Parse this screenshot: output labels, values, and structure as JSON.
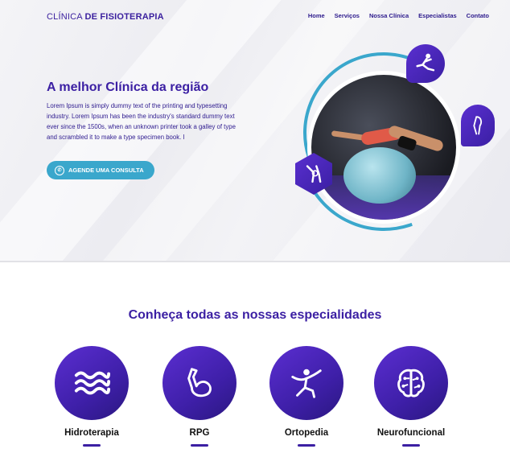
{
  "brand": {
    "light": "CLÍNICA ",
    "bold": "DE FISIOTERAPIA"
  },
  "nav": [
    "Home",
    "Serviços",
    "Nossa Clínica",
    "Especialistas",
    "Contato"
  ],
  "hero": {
    "title": "A melhor Clínica da região",
    "text": "Lorem Ipsum is simply dummy text of the printing and typesetting industry. Lorem Ipsum has been the industry's standard dummy text ever since the 1500s, when an unknown printer took a galley of type and scrambled it to make a type specimen book. I",
    "cta_label": "AGENDE  UMA CONSULTA",
    "cta_icon": "whatsapp-icon"
  },
  "colors": {
    "accent": "#3b1fa3",
    "cta": "#3aa7cc",
    "purple": "#5b2ed1"
  },
  "specialties": {
    "title": "Conheça todas as nossas especialidades",
    "items": [
      {
        "label": "Hidroterapia",
        "icon": "waves-icon"
      },
      {
        "label": "RPG",
        "icon": "flexed-arm-icon"
      },
      {
        "label": "Ortopedia",
        "icon": "stretching-person-icon"
      },
      {
        "label": "Neurofuncional",
        "icon": "brain-circuit-icon"
      }
    ]
  }
}
